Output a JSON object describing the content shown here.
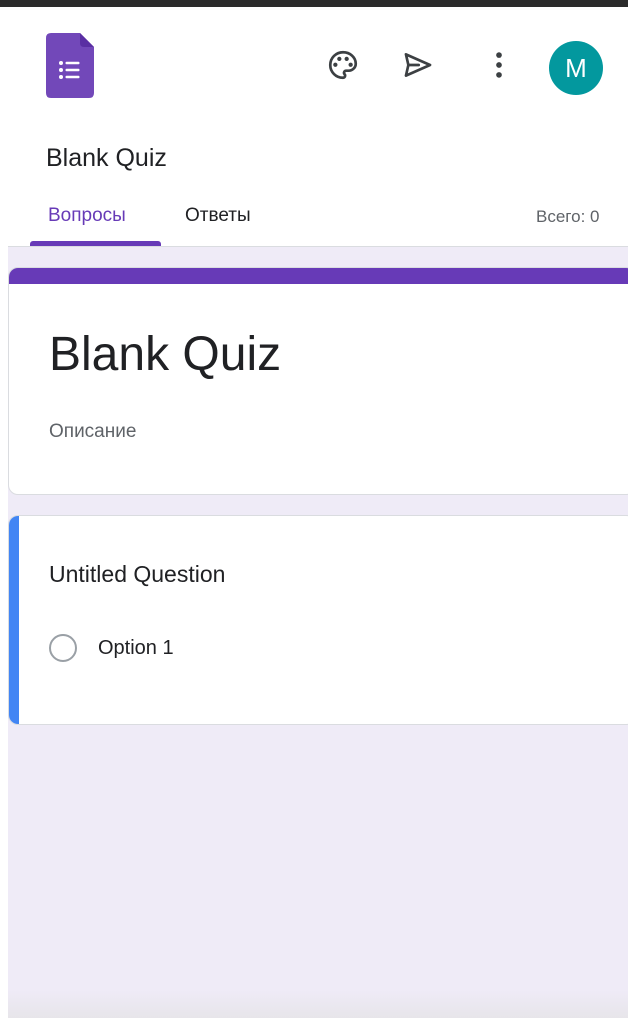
{
  "app": {
    "icon": "google-forms-logo",
    "document_title": "Blank Quiz"
  },
  "toolbar": {
    "palette_icon": "palette-icon",
    "send_icon": "send-icon",
    "more_icon": "more-vert-icon",
    "avatar_letter": "M",
    "avatar_color": "#03989e"
  },
  "tabs": [
    {
      "label": "Вопросы",
      "active": true
    },
    {
      "label": "Ответы",
      "active": false
    }
  ],
  "total_label": "Всего: 0",
  "form": {
    "title": "Blank Quiz",
    "description_placeholder": "Описание",
    "questions": [
      {
        "title": "Untitled Question",
        "type": "multiple-choice",
        "options": [
          "Option 1"
        ]
      }
    ]
  },
  "colors": {
    "accent_purple": "#673ab7",
    "question_focus_blue": "#4285f4",
    "form_background": "#efebf7"
  }
}
